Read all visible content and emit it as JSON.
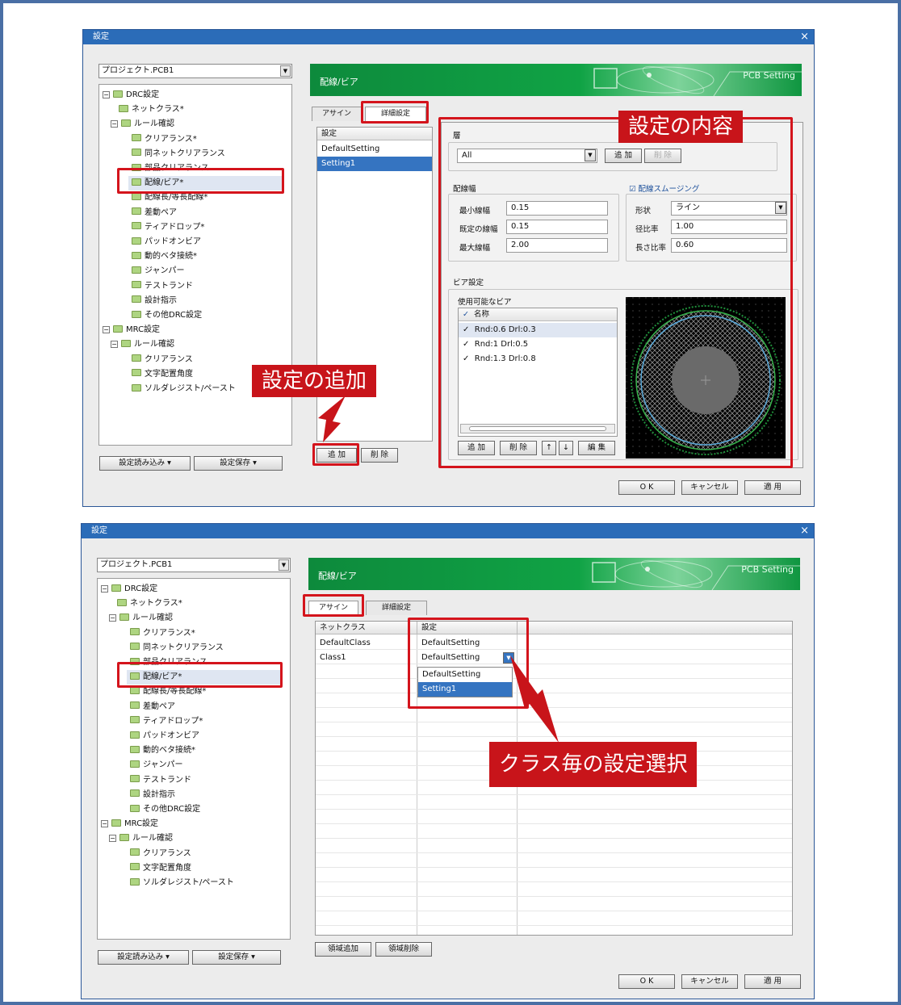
{
  "dialog1": {
    "title": "設定",
    "close": "×",
    "project": "プロジェクト.PCB1",
    "tree": [
      {
        "label": "DRC設定",
        "box": "⊟"
      },
      {
        "label": "ネットクラス*"
      },
      {
        "label": "ルール確認",
        "box": "⊟"
      },
      {
        "label": "クリアランス*"
      },
      {
        "label": "同ネットクリアランス"
      },
      {
        "label": "部品クリアランス"
      },
      {
        "label": "配線/ビア*"
      },
      {
        "label": "配線長/等長配線*"
      },
      {
        "label": "差動ペア"
      },
      {
        "label": "ティアドロップ*"
      },
      {
        "label": "パッドオンビア"
      },
      {
        "label": "動的ベタ接続*"
      },
      {
        "label": "ジャンパー"
      },
      {
        "label": "テストランド"
      },
      {
        "label": "設計指示"
      },
      {
        "label": "その他DRC設定"
      },
      {
        "label": "MRC設定",
        "box": "⊟"
      },
      {
        "label": "ルール確認",
        "box": "⊟"
      },
      {
        "label": "クリアランス"
      },
      {
        "label": "文字配置角度"
      },
      {
        "label": "ソルダレジスト/ペースト"
      }
    ],
    "load_btn": "設定読み込み ▾",
    "save_btn": "設定保存 ▾",
    "banner_title": "配線/ビア",
    "banner_sub": "PCB Setting",
    "tab_assign": "アサイン",
    "tab_detail": "詳細設定",
    "settings_header": "設定",
    "settings_rows": [
      "DefaultSetting",
      "Setting1"
    ],
    "add_btn": "追 加",
    "del_btn": "削 除",
    "layer_label": "層",
    "layer_value": "All",
    "layer_add": "追 加",
    "layer_del": "削 除",
    "width_label": "配線幅",
    "min_width_label": "最小線幅",
    "min_width": "0.15",
    "default_width_label": "既定の線幅",
    "default_width": "0.15",
    "max_width_label": "最大線幅",
    "max_width": "2.00",
    "smoothing_label": "配線スムージング",
    "shape_label": "形状",
    "shape_value": "ライン",
    "radius_label": "径比率",
    "radius_value": "1.00",
    "length_label": "長さ比率",
    "length_value": "0.60",
    "via_label": "ビア設定",
    "avail_via_label": "使用可能なビア",
    "via_header": "名称",
    "vias": [
      "Rnd:0.6  Drl:0.3",
      "Rnd:1  Drl:0.5",
      "Rnd:1.3  Drl:0.8"
    ],
    "via_add": "追 加",
    "via_del": "削 除",
    "via_up": "↑",
    "via_down": "↓",
    "via_edit": "編 集",
    "ok": "O K",
    "cancel": "キャンセル",
    "apply": "適 用",
    "callout_content": "設定の内容",
    "callout_add": "設定の追加"
  },
  "dialog2": {
    "title": "設定",
    "close": "×",
    "project": "プロジェクト.PCB1",
    "load_btn": "設定読み込み ▾",
    "save_btn": "設定保存 ▾",
    "banner_title": "配線/ビア",
    "banner_sub": "PCB Setting",
    "tab_assign": "アサイン",
    "tab_detail": "詳細設定",
    "col_netclass": "ネットクラス",
    "col_setting": "設定",
    "rows": [
      {
        "netclass": "DefaultClass",
        "setting": "DefaultSetting"
      },
      {
        "netclass": "Class1",
        "setting": "DefaultSetting"
      }
    ],
    "dropdown_options": [
      "DefaultSetting",
      "Setting1"
    ],
    "dropdown_selected": "Setting1",
    "area_add": "領域追加",
    "area_del": "領域削除",
    "ok": "O K",
    "cancel": "キャンセル",
    "apply": "適 用",
    "callout_select": "クラス毎の設定選択"
  },
  "colors": {
    "accent": "#2b6cb8",
    "highlight_red": "#d4141c",
    "banner_green": "#10a345",
    "selection": "#3574c1"
  }
}
